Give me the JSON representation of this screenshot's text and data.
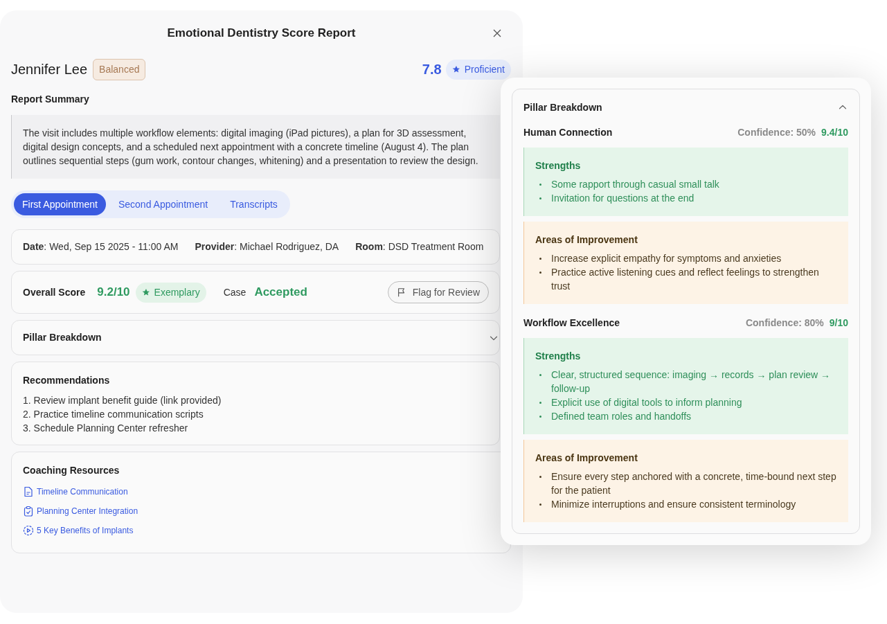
{
  "title": "Emotional Dentistry Score Report",
  "patient": {
    "name": "Jennifer Lee",
    "tag": "Balanced"
  },
  "score": {
    "value": "7.8",
    "rating": "Proficient"
  },
  "summary": {
    "heading": "Report Summary",
    "text": "The visit includes multiple workflow elements: digital imaging (iPad pictures), a plan for 3D assessment, digital design concepts, and a scheduled next appointment with a concrete timeline (August 4). The plan outlines sequential steps (gum work, contour changes, whitening) and a presentation to review the design."
  },
  "tabs": [
    {
      "label": "First Appointment",
      "selected": true
    },
    {
      "label": "Second Appointment",
      "selected": false
    },
    {
      "label": "Transcripts",
      "selected": false
    }
  ],
  "details": [
    "**Date**: Wed, Sep 15 2025 - 11:00 AM",
    "**Provider**: Michael Rodriguez, DA",
    "**Room**: DSD Treatment Room"
  ],
  "overall": {
    "label": "Overall Score",
    "score": "9.2/10",
    "rating": "Exemplary",
    "case_label": "Case",
    "case_status": "Accepted",
    "flag_button": "Flag for Review"
  },
  "pillar_section": {
    "title": "Pillar Breakdown",
    "expanded": false
  },
  "recommendations": {
    "heading": "Recommendations",
    "items": [
      "1. Review implant benefit guide (link provided)",
      "2. Practice timeline communication scripts",
      "3. Schedule Planning Center refresher"
    ]
  },
  "coaching": {
    "heading": "Coaching Resources",
    "resources": [
      {
        "kind": "document",
        "label": "Timeline Communication"
      },
      {
        "kind": "checklist",
        "label": "Planning Center Integration"
      },
      {
        "kind": "video",
        "label": "5 Key Benefits of Implants"
      }
    ]
  },
  "pillar_panel": {
    "title": "Pillar Breakdown",
    "expanded": true,
    "pillars": [
      {
        "name": "Human Connection",
        "confidence": "Confidence: 50%",
        "score": "9.4/10",
        "sections": [
          {
            "kind": "strengths",
            "heading": "Strengths",
            "items": [
              "Some rapport through casual small talk",
              "Invitation for questions at the end"
            ]
          },
          {
            "kind": "improvement",
            "heading": "Areas of Improvement",
            "items": [
              "Increase explicit empathy for symptoms and anxieties",
              "Practice active listening cues and reflect feelings to strengthen trust"
            ]
          }
        ]
      },
      {
        "name": "Workflow Excellence",
        "confidence": "Confidence: 80%",
        "score": "9/10",
        "sections": [
          {
            "kind": "strengths",
            "heading": "Strengths",
            "items": [
              "Clear, structured sequence: imaging → records → plan review → follow-up",
              "Explicit use of digital tools to inform planning",
              "Defined team roles and handoffs"
            ]
          },
          {
            "kind": "improvement",
            "heading": "Areas of Improvement",
            "items": [
              "Ensure every step anchored with a concrete, time-bound next step for the patient",
              "Minimize interruptions and ensure consistent terminology"
            ]
          }
        ]
      }
    ]
  }
}
